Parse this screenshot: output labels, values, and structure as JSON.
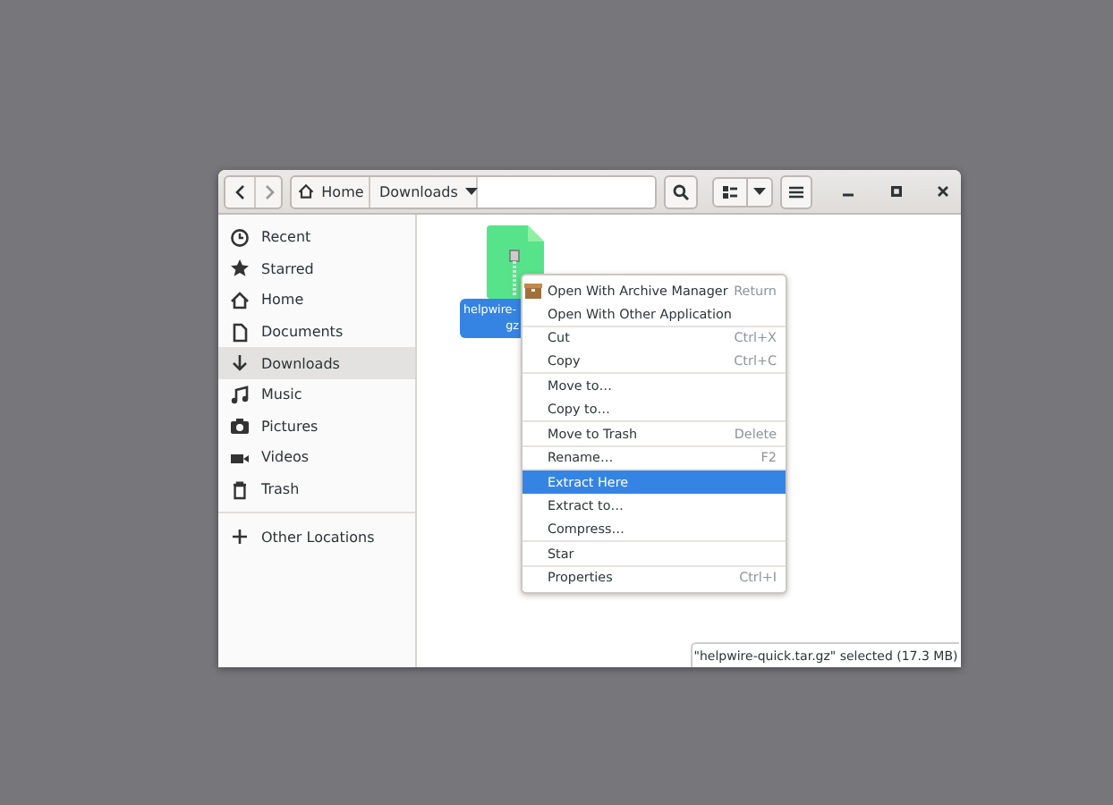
{
  "window": {
    "path_bar": [
      {
        "label": "Home"
      },
      {
        "label": "Downloads"
      }
    ]
  },
  "sidebar": {
    "items": [
      {
        "label": "Recent",
        "selected": false
      },
      {
        "label": "Starred",
        "selected": false
      },
      {
        "label": "Home",
        "selected": false
      },
      {
        "label": "Documents",
        "selected": false
      },
      {
        "label": "Downloads",
        "selected": true
      },
      {
        "label": "Music",
        "selected": false
      },
      {
        "label": "Pictures",
        "selected": false
      },
      {
        "label": "Videos",
        "selected": false
      },
      {
        "label": "Trash",
        "selected": false
      }
    ],
    "other": {
      "label": "Other Locations"
    }
  },
  "files": [
    {
      "label_lines": [
        "helpwire-",
        "gz"
      ],
      "selected": true
    }
  ],
  "context_menu": {
    "sections": [
      [
        {
          "label": "Open With Archive Manager",
          "shortcut": "Return",
          "selected": false
        },
        {
          "label": "Open With Other Application",
          "selected": false
        }
      ],
      [
        {
          "label": "Cut",
          "shortcut": "Ctrl+X",
          "selected": false
        },
        {
          "label": "Copy",
          "shortcut": "Ctrl+C",
          "selected": false
        }
      ],
      [
        {
          "label": "Move to…",
          "selected": false
        },
        {
          "label": "Copy to…",
          "selected": false
        }
      ],
      [
        {
          "label": "Move to Trash",
          "shortcut": "Delete",
          "selected": false
        }
      ],
      [
        {
          "label": "Rename…",
          "shortcut": "F2",
          "selected": false
        }
      ],
      [
        {
          "label": "Extract Here",
          "selected": true
        },
        {
          "label": "Extract to…",
          "selected": false
        },
        {
          "label": "Compress…",
          "selected": false
        }
      ],
      [
        {
          "label": "Star",
          "selected": false
        }
      ],
      [
        {
          "label": "Properties",
          "shortcut": "Ctrl+I",
          "selected": false
        }
      ]
    ]
  },
  "status": "\"helpwire-quick.tar.gz\" selected (17.3 MB)"
}
